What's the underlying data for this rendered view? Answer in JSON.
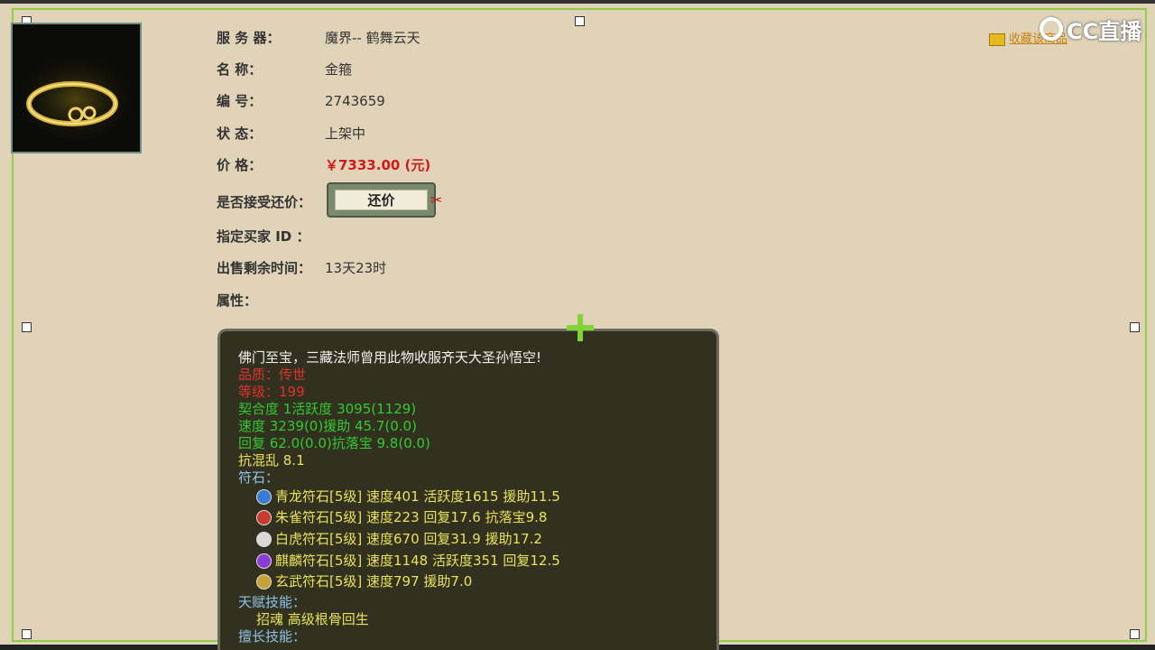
{
  "server": {
    "label": "服 务 器：",
    "value": "魔界-- 鹤舞云天"
  },
  "name": {
    "label": "名      称：",
    "value": "金箍"
  },
  "number": {
    "label": "编      号：",
    "value": "2743659"
  },
  "status": {
    "label": "状      态：",
    "value": "上架中"
  },
  "price": {
    "label": "价      格：",
    "value": "￥7333.00 (元)"
  },
  "bargain": {
    "label": "是否接受还价：",
    "button": "还价"
  },
  "buyer": {
    "label": "指定买家 ID ："
  },
  "remaining": {
    "label": "出售剩余时间：",
    "value": "13天23时"
  },
  "attrs": {
    "label": "属性："
  },
  "favorite": {
    "label": "收藏该商品"
  },
  "logo": {
    "text": "CC直播"
  },
  "tooltip": {
    "desc": "佛门至宝，三藏法师曾用此物收服齐天大圣孙悟空!",
    "quality": "品质：传世",
    "level": "等级：199",
    "stats1": "契合度    1活跃度  3095(1129)",
    "stats2": "速度    3239(0)援助    45.7(0.0)",
    "stats3": "回复    62.0(0.0)抗落宝     9.8(0.0)",
    "stats4": "抗混乱 8.1",
    "runes_label": "符石：",
    "runes": [
      {
        "text": "青龙符石[5级] 速度401 活跃度1615 援助11.5",
        "color": "#3a7bd5"
      },
      {
        "text": "朱雀符石[5级] 速度223 回复17.6 抗落宝9.8",
        "color": "#c83a2a"
      },
      {
        "text": "白虎符石[5级] 速度670 回复31.9 援助17.2",
        "color": "#d8d8d8"
      },
      {
        "text": "麒麟符石[5级] 速度1148 活跃度351 回复12.5",
        "color": "#8a3ad5"
      },
      {
        "text": "玄武符石[5级] 速度797 援助7.0",
        "color": "#c8a03a"
      }
    ],
    "talent_label": "天赋技能：",
    "talent": "招魂     高级根骨回生",
    "skill_label": "擅长技能："
  },
  "colors": {
    "bg": "#e0d3b7",
    "red": "#d21a1a",
    "green": "#32c832",
    "yellow": "#e8e25a",
    "blue": "#8fc3e8"
  }
}
